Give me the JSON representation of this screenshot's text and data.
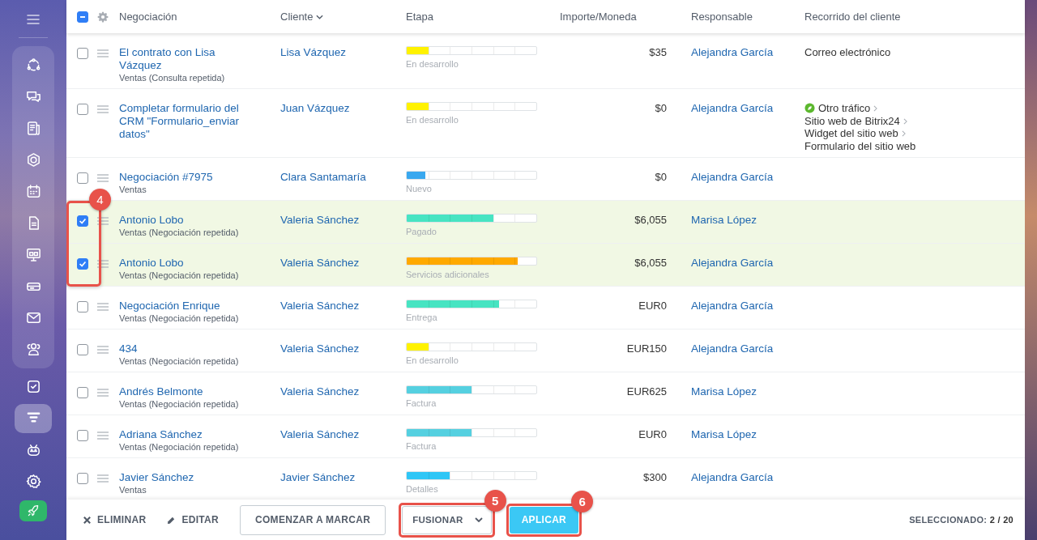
{
  "sidebar": {
    "items": [
      {
        "selected": false
      },
      {
        "selected": false
      },
      {
        "selected": false
      },
      {
        "selected": false
      },
      {
        "selected": false
      },
      {
        "selected": false
      },
      {
        "selected": false
      },
      {
        "selected": false
      },
      {
        "selected": false
      },
      {
        "selected": false
      },
      {
        "selected": false
      },
      {
        "selected": true
      },
      {
        "selected": false
      },
      {
        "selected": false
      },
      {
        "selected": false
      }
    ]
  },
  "table": {
    "select_all": {
      "indeterminate": true
    },
    "columns": [
      {
        "label": "Negociación",
        "sorted": false
      },
      {
        "label": "Cliente",
        "sorted": true
      },
      {
        "label": "Etapa",
        "sorted": false
      },
      {
        "label": "Importe/Moneda",
        "sorted": false
      },
      {
        "label": "Responsable",
        "sorted": false
      },
      {
        "label": "Recorrido del cliente",
        "sorted": false
      }
    ],
    "rows": [
      {
        "selected": false,
        "name": "El contrato con Lisa Vázquez",
        "pipeline": "Ventas (Consulta repetida)",
        "client": "Lisa Vázquez",
        "stage": {
          "label": "En desarrollo",
          "level": 0.167,
          "color": "#fff200"
        },
        "amount": "$35",
        "responsible": "Alejandra García",
        "journey": {
          "source_icon": false,
          "steps": [
            "Correo electrónico"
          ]
        }
      },
      {
        "selected": false,
        "name": "Completar formulario del CRM \"Formulario_enviar datos\"",
        "client": "Juan Vázquez",
        "stage": {
          "label": "En desarrollo",
          "level": 0.167,
          "color": "#fff200"
        },
        "amount": "$0",
        "responsible": "Alejandra García",
        "journey": {
          "source_icon": true,
          "steps": [
            "Otro tráfico",
            "Sitio web de Bitrix24",
            "Widget del sitio web",
            "Formulario del sitio web"
          ]
        }
      },
      {
        "selected": false,
        "name": "Negociación #7975",
        "pipeline": "Ventas",
        "client": "Clara Santamaría",
        "stage": {
          "label": "Nuevo",
          "level": 0.143,
          "color": "#39a8ef"
        },
        "amount": "$0",
        "responsible": "Alejandra García"
      },
      {
        "selected": true,
        "name": "Antonio Lobo",
        "pipeline": "Ventas (Negociación repetida)",
        "client": "Valeria Sánchez",
        "stage": {
          "label": "Pagado",
          "level": 0.667,
          "color": "#47e4c2"
        },
        "amount": "$6,055",
        "responsible": "Marisa López"
      },
      {
        "selected": true,
        "name": "Antonio Lobo",
        "pipeline": "Ventas (Negociación repetida)",
        "client": "Valeria Sánchez",
        "stage": {
          "label": "Servicios adicionales",
          "level": 0.857,
          "color": "#ffa900"
        },
        "amount": "$6,055",
        "responsible": "Alejandra García"
      },
      {
        "selected": false,
        "name": "Negociación Enrique",
        "pipeline": "Ventas (Negociación repetida)",
        "client": "Valeria Sánchez",
        "stage": {
          "label": "Entrega",
          "level": 0.714,
          "color": "#47e4c2"
        },
        "amount": "EUR0",
        "responsible": "Alejandra García"
      },
      {
        "selected": false,
        "name": "434",
        "pipeline": "Ventas (Negociación repetida)",
        "client": "Valeria Sánchez",
        "stage": {
          "label": "En desarrollo",
          "level": 0.167,
          "color": "#fff200"
        },
        "amount": "EUR150",
        "responsible": "Alejandra García"
      },
      {
        "selected": false,
        "name": "Andrés Belmonte",
        "pipeline": "Ventas (Negociación repetida)",
        "client": "Valeria Sánchez",
        "stage": {
          "label": "Factura",
          "level": 0.5,
          "color": "#55d0e0"
        },
        "amount": "EUR625",
        "responsible": "Marisa López"
      },
      {
        "selected": false,
        "name": "Adriana Sánchez",
        "pipeline": "Ventas (Negociación repetida)",
        "client": "Valeria Sánchez",
        "stage": {
          "label": "Factura",
          "level": 0.5,
          "color": "#55d0e0"
        },
        "amount": "EUR0",
        "responsible": "Marisa López"
      },
      {
        "selected": false,
        "name": "Javier Sánchez",
        "pipeline": "Ventas",
        "client": "Javier Sánchez",
        "stage": {
          "label": "Detalles",
          "level": 0.333,
          "color": "#2fc6f6"
        },
        "amount": "$300",
        "responsible": "Alejandra García"
      }
    ]
  },
  "footer": {
    "actions": [
      {
        "label": "ELIMINAR",
        "kind": "delete"
      },
      {
        "label": "EDITAR",
        "kind": "edit"
      },
      {
        "label": "COMENZAR A MARCAR",
        "kind": "outlined"
      }
    ],
    "dropdown": {
      "value": "FUSIONAR"
    },
    "apply": {
      "label": "APLICAR"
    },
    "selected_label": "SELECCIONADO:",
    "selected_count": "2 / 20"
  },
  "callouts": [
    {
      "number": "4"
    },
    {
      "number": "5"
    },
    {
      "number": "6"
    }
  ]
}
